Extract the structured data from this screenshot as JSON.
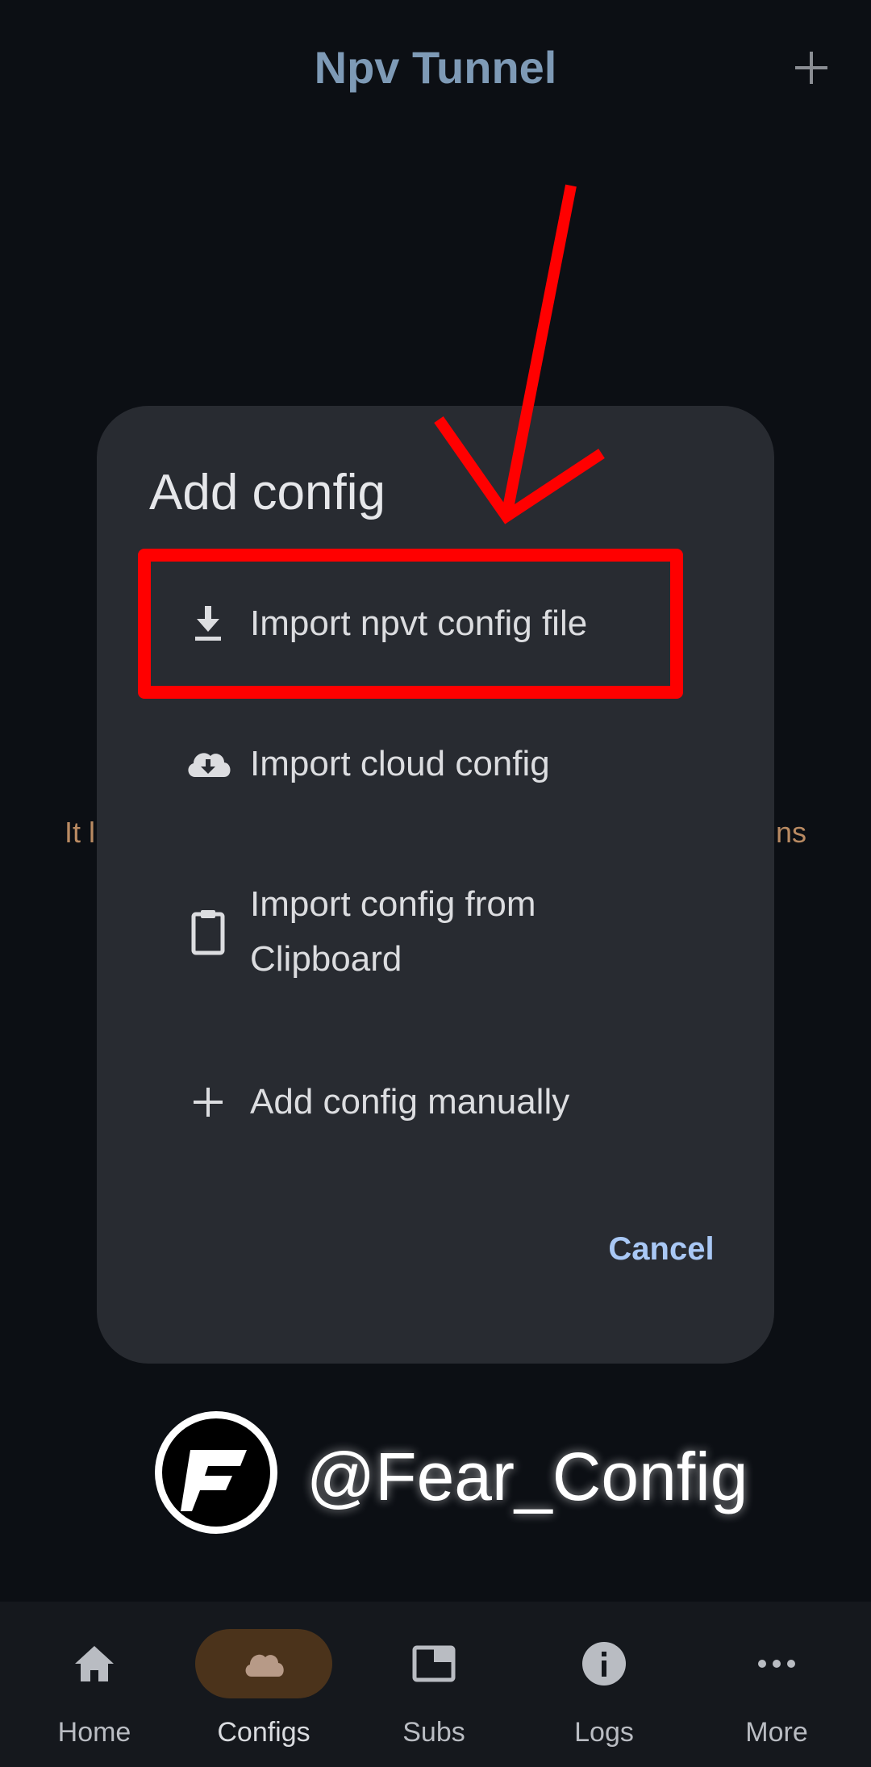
{
  "app_bar": {
    "title": "Npv Tunnel",
    "add_icon": "plus-icon"
  },
  "background": {
    "hint_left": "It l",
    "hint_right": "ns"
  },
  "dialog": {
    "title": "Add config",
    "items": [
      {
        "label": "Import npvt config file",
        "icon": "download-icon"
      },
      {
        "label": "Import cloud config",
        "icon": "cloud-download-icon"
      },
      {
        "label": "Import config from Clipboard",
        "icon": "clipboard-icon"
      },
      {
        "label": "Add config manually",
        "icon": "plus-icon"
      }
    ],
    "cancel_label": "Cancel"
  },
  "watermark": {
    "text": "@Fear_Config",
    "logo_letter": "F"
  },
  "bottom_nav": {
    "items": [
      {
        "label": "Home",
        "icon": "home-icon",
        "active": false
      },
      {
        "label": "Configs",
        "icon": "cloud-icon",
        "active": true
      },
      {
        "label": "Subs",
        "icon": "subscriptions-icon",
        "active": false
      },
      {
        "label": "Logs",
        "icon": "info-icon",
        "active": false
      },
      {
        "label": "More",
        "icon": "more-horizontal-icon",
        "active": false
      }
    ]
  },
  "colors": {
    "background": "#0c0f14",
    "dialog": "#282b31",
    "title": "#7e9ab6",
    "accent_active": "#4b331b",
    "cancel": "#a9c8f5",
    "annotation": "#ff0000"
  }
}
